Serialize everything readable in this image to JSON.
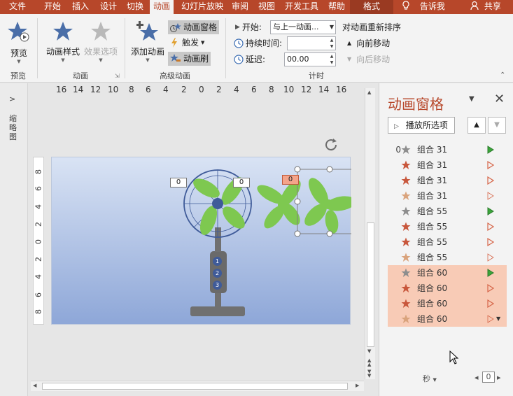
{
  "tabs": [
    {
      "label": "文件",
      "active": false
    },
    {
      "label": "开始",
      "active": false
    },
    {
      "label": "插入",
      "active": false
    },
    {
      "label": "设计",
      "active": false
    },
    {
      "label": "切换",
      "active": false
    },
    {
      "label": "动画",
      "active": true
    },
    {
      "label": "幻灯片放映",
      "active": false
    },
    {
      "label": "审阅",
      "active": false
    },
    {
      "label": "视图",
      "active": false
    },
    {
      "label": "开发工具",
      "active": false
    },
    {
      "label": "帮助",
      "active": false
    },
    {
      "label": "格式",
      "active": false
    }
  ],
  "tellme": "告诉我",
  "share": "共享",
  "ribbon": {
    "preview": {
      "button": "预览",
      "group": "预览"
    },
    "animation": {
      "style_button": "动画样式",
      "effect_button": "效果选项",
      "group": "动画"
    },
    "advanced": {
      "add_button": "添加动画",
      "pane_button": "动画窗格",
      "trigger_button": "触发",
      "painter_button": "动画刷",
      "group": "高级动画"
    },
    "timing": {
      "start_label": "开始:",
      "start_value": "与上一动画...",
      "duration_label": "持续时间:",
      "duration_value": "",
      "delay_label": "延迟:",
      "delay_value": "00.00",
      "group": "计时"
    },
    "reorder": {
      "title": "对动画重新排序",
      "earlier": "向前移动",
      "later": "向后移动"
    }
  },
  "left_panel_label": "缩略图",
  "ruler": {
    "horizontal": [
      "16",
      "14",
      "12",
      "10",
      "8",
      "6",
      "4",
      "2",
      "0",
      "2",
      "4",
      "6",
      "8",
      "10",
      "12",
      "14",
      "16"
    ],
    "vertical": [
      "8",
      "6",
      "4",
      "2",
      "0",
      "2",
      "4",
      "6",
      "8"
    ]
  },
  "slide": {
    "tags": [
      "0",
      "0",
      "0"
    ],
    "badges": [
      "1",
      "2",
      "3"
    ]
  },
  "anim_pane": {
    "title": "动画窗格",
    "play_button": "播放所选项",
    "items": [
      {
        "num": "0",
        "star": "gray",
        "name": "组合 31",
        "tri": "filled",
        "sel": false
      },
      {
        "num": "",
        "star": "red",
        "name": "组合 31",
        "tri": "outline",
        "sel": false
      },
      {
        "num": "",
        "star": "red",
        "name": "组合 31",
        "tri": "outline",
        "sel": false
      },
      {
        "num": "",
        "star": "tan",
        "name": "组合 31",
        "tri": "thin",
        "sel": false
      },
      {
        "num": "",
        "star": "gray",
        "name": "组合 55",
        "tri": "filled",
        "sel": false
      },
      {
        "num": "",
        "star": "red",
        "name": "组合 55",
        "tri": "outline",
        "sel": false
      },
      {
        "num": "",
        "star": "red",
        "name": "组合 55",
        "tri": "outline",
        "sel": false
      },
      {
        "num": "",
        "star": "tan",
        "name": "组合 55",
        "tri": "thin",
        "sel": false
      },
      {
        "num": "",
        "star": "gray",
        "name": "组合 60",
        "tri": "filled",
        "sel": true
      },
      {
        "num": "",
        "star": "red",
        "name": "组合 60",
        "tri": "outline",
        "sel": true
      },
      {
        "num": "",
        "star": "red",
        "name": "组合 60",
        "tri": "outline",
        "sel": true
      },
      {
        "num": "",
        "star": "tan",
        "name": "组合 60",
        "tri": "thin",
        "sel": true
      }
    ],
    "seconds_label": "秒",
    "zoom_value": "0"
  },
  "colors": {
    "accent": "#b7472a",
    "selection": "#f8cbb6",
    "star_gray": "#8e8e8e",
    "star_red": "#c8573c",
    "star_tan": "#d9a37c",
    "tri_green": "#3aa53a",
    "tri_red": "#d6674a"
  }
}
